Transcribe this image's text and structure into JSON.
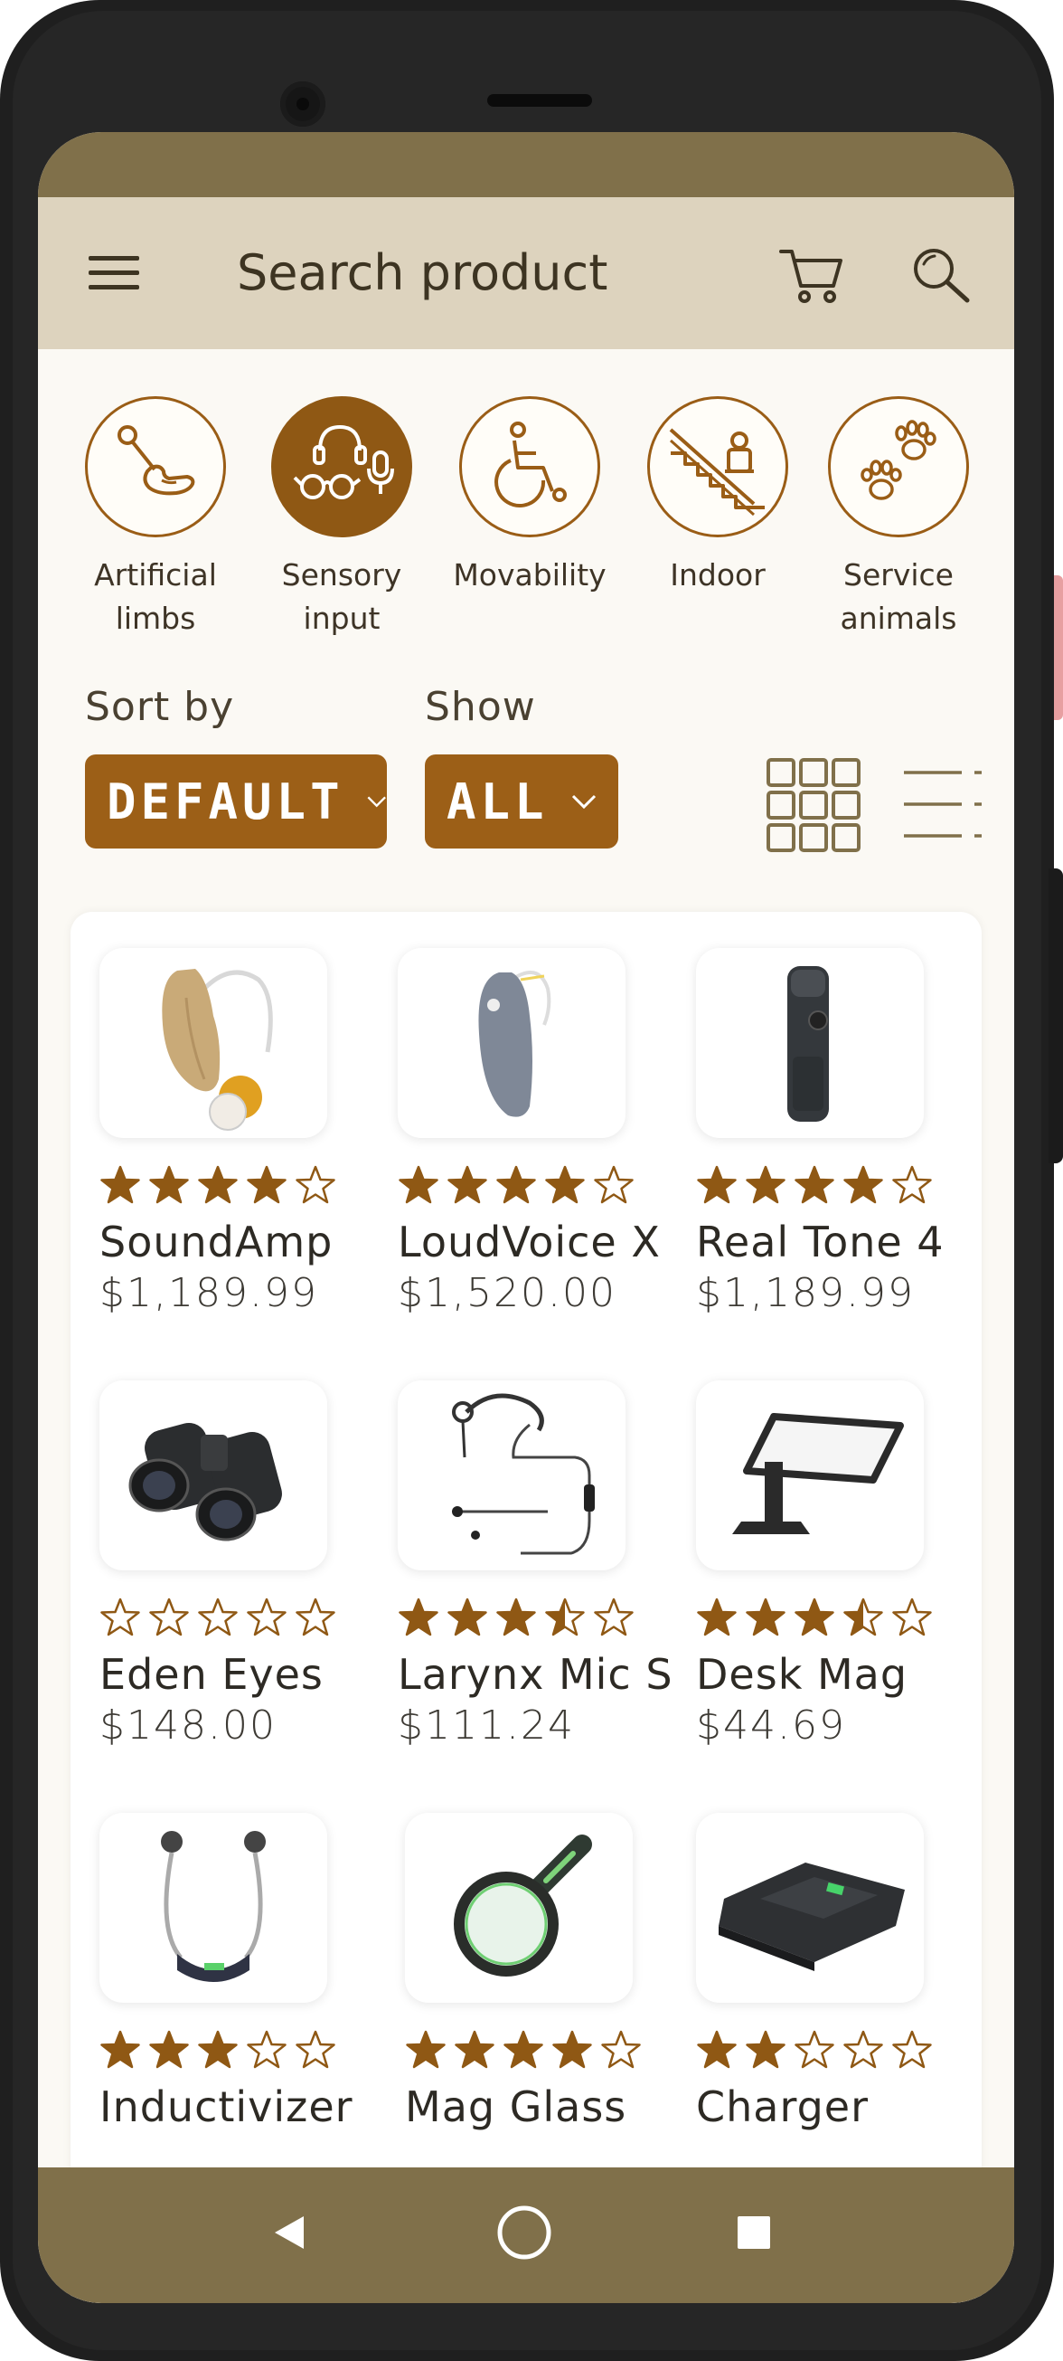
{
  "appbar": {
    "title": "Search product"
  },
  "categories": [
    {
      "label": "Artificial\nlimbs",
      "icon": "prosthetic-arm-icon",
      "active": false
    },
    {
      "label": "Sensory\ninput",
      "icon": "sensory-glasses-icon",
      "active": true
    },
    {
      "label": "Movability",
      "icon": "wheelchair-icon",
      "active": false
    },
    {
      "label": "Indoor",
      "icon": "stairlift-icon",
      "active": false
    },
    {
      "label": "Service\nanimals",
      "icon": "paw-prints-icon",
      "active": false
    }
  ],
  "filters": {
    "sort_label": "Sort by",
    "sort_value": "DEFAULT",
    "show_label": "Show",
    "show_value": "ALL"
  },
  "products": [
    {
      "name": "SoundAmp",
      "price": "$1,189.99",
      "rating": 4,
      "image": "hearing-aid-beige-icon"
    },
    {
      "name": "LoudVoice X",
      "price": "$1,520.00",
      "rating": 4,
      "image": "hearing-aid-grey-icon"
    },
    {
      "name": "Real Tone 4",
      "price": "$1,189.99",
      "rating": 4,
      "image": "pocket-amplifier-icon"
    },
    {
      "name": "Eden Eyes",
      "price": "$148.00",
      "rating": 0,
      "image": "binoculars-icon"
    },
    {
      "name": "Larynx Mic S",
      "price": "$111.24",
      "rating": 3.5,
      "image": "throat-mic-icon"
    },
    {
      "name": "Desk Mag",
      "price": "$44.69",
      "rating": 3.5,
      "image": "desk-magnifier-icon"
    },
    {
      "name": "Inductivizer",
      "price": "",
      "rating": 3,
      "image": "neckloop-icon"
    },
    {
      "name": "Mag Glass",
      "price": "",
      "rating": 4,
      "image": "magnifying-glass-icon"
    },
    {
      "name": "Charger",
      "price": "",
      "rating": 2,
      "image": "charger-icon"
    }
  ],
  "colors": {
    "accent": "#9c5f17",
    "header": "#ddd3be",
    "bar": "#80704a",
    "star": "#8f5814"
  }
}
